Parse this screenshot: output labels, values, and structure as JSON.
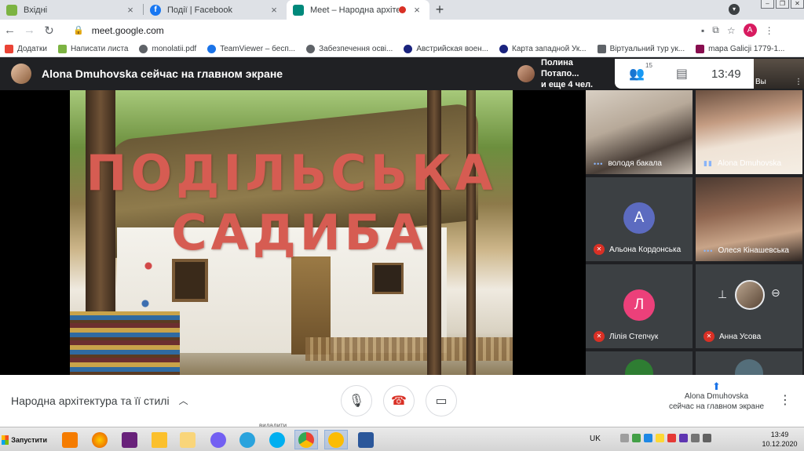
{
  "browser": {
    "tabs": [
      {
        "title": "Вхідні",
        "close": "×",
        "favicon_color": "#7cb342"
      },
      {
        "title": "Події | Facebook",
        "close": "×",
        "favicon_color": "#1877f2"
      },
      {
        "title": "Meet – Народна архітектура",
        "close": "×",
        "favicon_color": "#00897b"
      }
    ],
    "new_tab": "+",
    "url": "meet.google.com",
    "profile_initial": "A",
    "bookmarks": [
      {
        "label": "Додатки",
        "color": "#ea4335"
      },
      {
        "label": "Написати листа",
        "color": "#7cb342"
      },
      {
        "label": "monolatii.pdf",
        "color": "#5f6368"
      },
      {
        "label": "TeamViewer – бесп...",
        "color": "#1a73e8"
      },
      {
        "label": "Забезпечення осві...",
        "color": "#5f6368"
      },
      {
        "label": "Австрийская воен...",
        "color": "#1a237e"
      },
      {
        "label": "Карта западной Ук...",
        "color": "#1a237e"
      },
      {
        "label": "Віртуальний тур ук...",
        "color": "#5f6368"
      },
      {
        "label": "mapa Galicji 1779-1...",
        "color": "#880e4f"
      }
    ]
  },
  "meet": {
    "presenter_label": "Alona Dmuhovska сейчас на главном экране",
    "slide": {
      "line1": "ПОДІЛЬСЬКА",
      "line2": "САДИБА"
    },
    "people_preview": {
      "line1": "Полина Потапо...",
      "line2": "и еще 4 чел."
    },
    "participant_count": "15",
    "time": "13:49",
    "self_label": "Вы",
    "participants": [
      {
        "name": "володя бакала",
        "type": "photo"
      },
      {
        "name": "Alona Dmuhovska",
        "type": "photo"
      },
      {
        "name": "Альона Кордонська",
        "type": "letter",
        "letter": "А",
        "color": "#5c6bc0"
      },
      {
        "name": "Олеся Кінашевська",
        "type": "photo"
      },
      {
        "name": "Лілія Степчук",
        "type": "letter",
        "letter": "Л",
        "color": "#ec407a"
      },
      {
        "name": "Анна Усова",
        "type": "avatar"
      }
    ],
    "meeting_title": "Народна архітектура та її стилі",
    "present_line1": "Alona Dmuhovska",
    "present_line2": "сейчас на главном экране",
    "hint_text": "видалити"
  },
  "taskbar": {
    "start_label": "Запустити",
    "lang": "UK",
    "time": "13:49",
    "date": "10.12.2020"
  },
  "colors": {
    "accent": "#1a73e8",
    "danger": "#d93025",
    "meet_bg": "#202124"
  }
}
